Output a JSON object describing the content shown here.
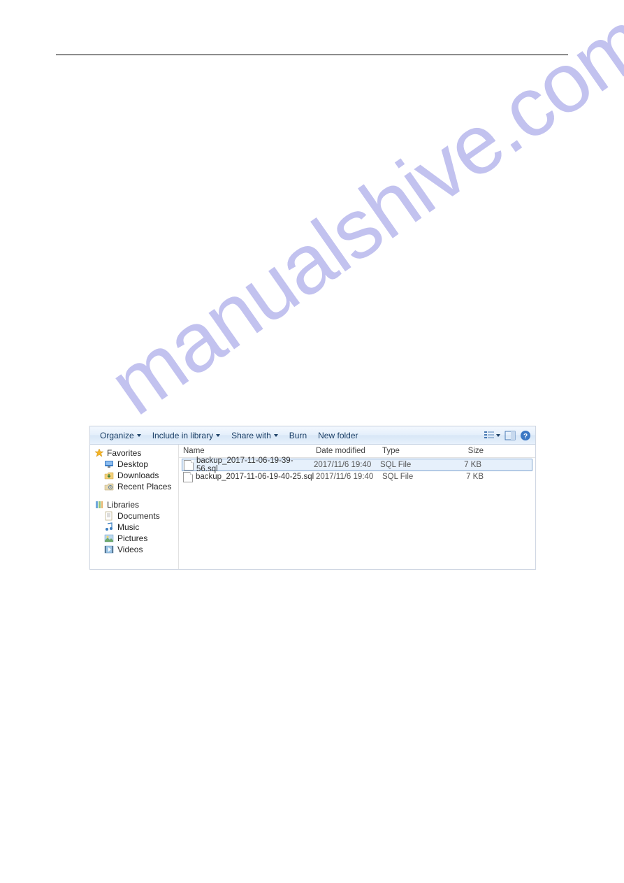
{
  "watermark": "manualshive.com",
  "toolbar": {
    "organize": "Organize",
    "include": "Include in library",
    "share": "Share with",
    "burn": "Burn",
    "newfolder": "New folder"
  },
  "nav": {
    "favorites": "Favorites",
    "desktop": "Desktop",
    "downloads": "Downloads",
    "recent": "Recent Places",
    "libraries": "Libraries",
    "documents": "Documents",
    "music": "Music",
    "pictures": "Pictures",
    "videos": "Videos"
  },
  "columns": {
    "name": "Name",
    "date": "Date modified",
    "type": "Type",
    "size": "Size"
  },
  "files": [
    {
      "name": "backup_2017-11-06-19-39-56.sql",
      "date": "2017/11/6 19:40",
      "type": "SQL File",
      "size": "7 KB",
      "selected": true
    },
    {
      "name": "backup_2017-11-06-19-40-25.sql",
      "date": "2017/11/6 19:40",
      "type": "SQL File",
      "size": "7 KB",
      "selected": false
    }
  ]
}
